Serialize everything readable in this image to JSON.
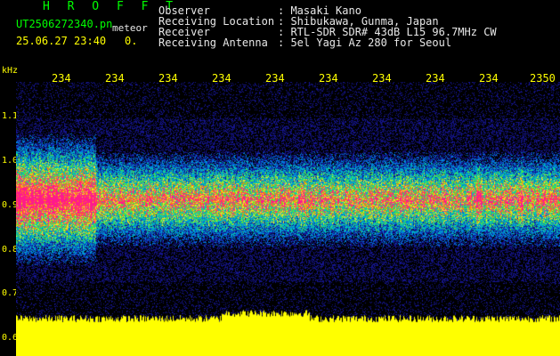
{
  "header": {
    "app_name": "H R O F F T",
    "filename": "UT2506272340.pn",
    "suffix": "meteor",
    "datetime": "25.06.27 23:40",
    "index": "0."
  },
  "info": [
    {
      "label": "Observer",
      "value": ": Masaki Kano"
    },
    {
      "label": "Receiving Location",
      "value": ": Shibukawa, Gunma, Japan"
    },
    {
      "label": "Receiver",
      "value": ": RTL-SDR SDR# 43dB L15 96.7MHz CW"
    },
    {
      "label": "Receiving Antenna",
      "value": ": 5el Yagi Az 280 for Seoul"
    }
  ],
  "axis": {
    "y_unit": "kHz",
    "y_ticks": [
      "1.1",
      "1.0",
      "0.9",
      "0.8",
      "0.7",
      "0.6"
    ],
    "x_ticks": [
      "234",
      "234",
      "234",
      "234",
      "234",
      "234",
      "234",
      "234",
      "234",
      "2350"
    ]
  },
  "colors": {
    "background": "#000000",
    "title": "#00ff00",
    "axis": "#ffff00",
    "signal": "#ff1a8c",
    "floor": "#1010a0",
    "level": "#ffff00"
  }
}
